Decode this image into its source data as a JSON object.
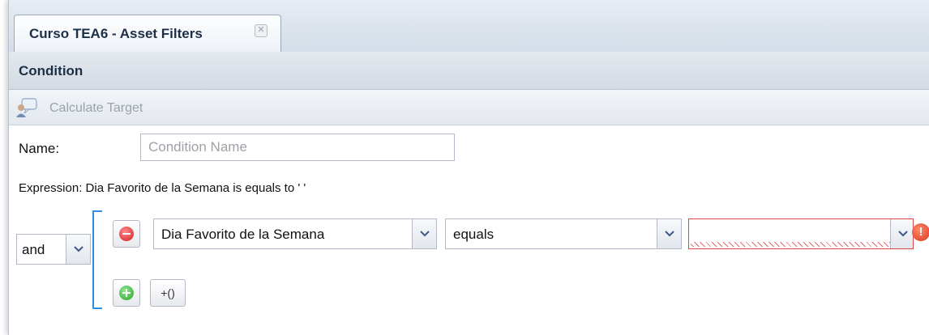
{
  "tab": {
    "title": "Curso TEA6 - Asset Filters",
    "close_glyph": "✕"
  },
  "panel": {
    "title": "Condition"
  },
  "toolbar": {
    "calculate_label": "Calculate Target",
    "calculate_icon": "calculate-target-icon"
  },
  "form": {
    "name_label": "Name:",
    "name_value": "",
    "name_placeholder": "Condition Name",
    "expression": "Expression: Dia Favorito de la Semana is equals to ' '"
  },
  "condition": {
    "logic_operator": "and",
    "field": "Dia Favorito de la Semana",
    "operator": "equals",
    "value": "",
    "add_group_label": "+()",
    "remove_icon": "minus-circle-icon",
    "add_icon": "plus-circle-icon",
    "error_glyph": "!"
  },
  "colors": {
    "accent": "#2f8fde",
    "error": "#e04545",
    "remove": "#d42020",
    "add": "#2aa42a"
  }
}
